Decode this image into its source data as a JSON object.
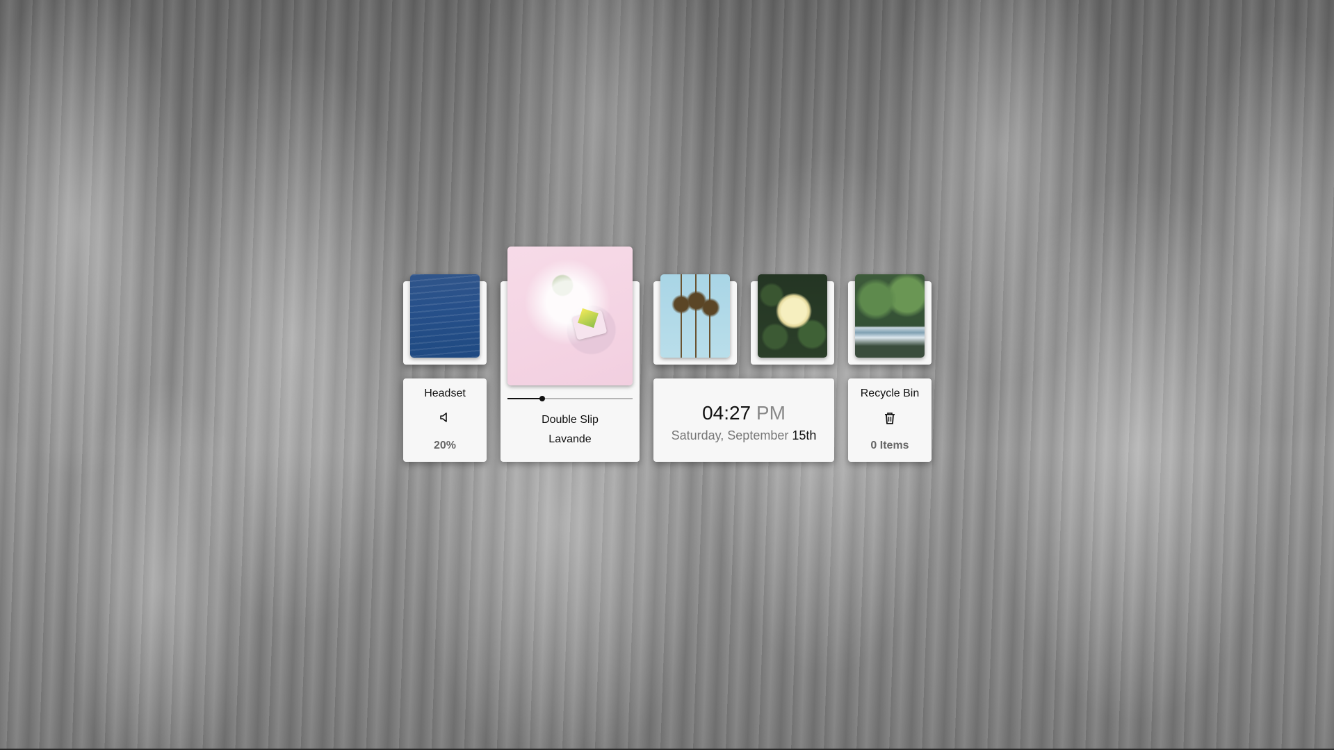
{
  "volume_widget": {
    "device": "Headset",
    "level_label": "20%",
    "level": 0.2,
    "icon": "speaker-icon"
  },
  "media_widget": {
    "title": "Double Slip",
    "artist": "Lavande",
    "progress": 0.28
  },
  "clock_widget": {
    "time": "04:27",
    "ampm": "PM",
    "date": "Saturday, September",
    "day": "15th"
  },
  "recycle_widget": {
    "title": "Recycle Bin",
    "icon": "trash-icon",
    "items_label": "0 Items"
  },
  "colors": {
    "card_bg": "#f7f7f7",
    "text": "#222222",
    "muted_text": "#666666"
  }
}
